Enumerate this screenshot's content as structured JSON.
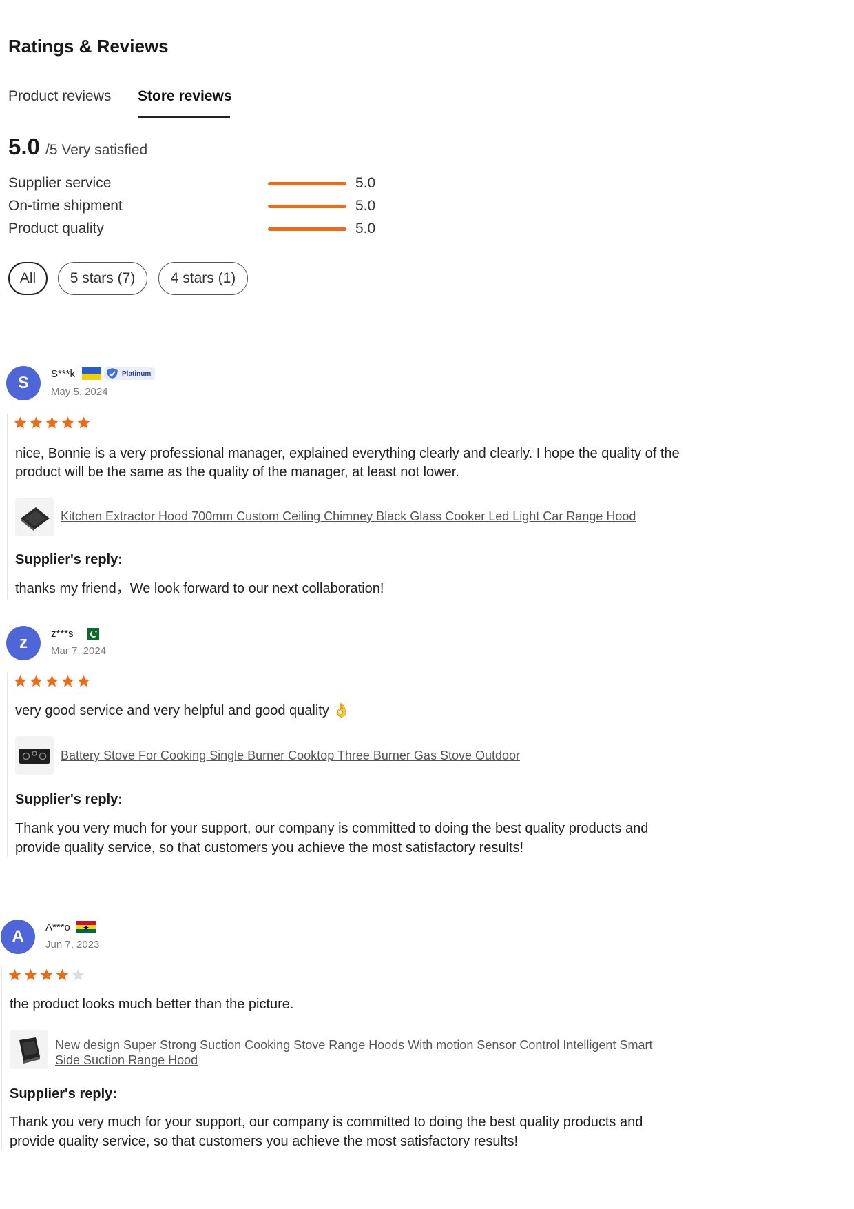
{
  "header": {
    "title": "Ratings & Reviews"
  },
  "tabs": [
    {
      "label": "Product reviews",
      "active": false
    },
    {
      "label": "Store reviews",
      "active": true
    }
  ],
  "summary": {
    "score": "5.0",
    "suffix": "/5 Very satisfied",
    "metrics": [
      {
        "label": "Supplier service",
        "value": "5.0",
        "fraction": 1.0
      },
      {
        "label": "On-time shipment",
        "value": "5.0",
        "fraction": 1.0
      },
      {
        "label": "Product quality",
        "value": "5.0",
        "fraction": 1.0
      }
    ]
  },
  "filters": [
    {
      "label": "All",
      "active": true
    },
    {
      "label": "5 stars (7)",
      "active": false
    },
    {
      "label": "4 stars (1)",
      "active": false
    }
  ],
  "reviews": [
    {
      "initial": "S",
      "user": "S***k",
      "country_flag": "ukraine-flag-icon",
      "badge": "Platinum",
      "date": "May 5, 2024",
      "rating": 5,
      "text": "nice, Bonnie is a very professional manager, explained everything clearly and clearly. I hope the quality of the product will be the same as the quality of the manager, at least not lower.",
      "product": "Kitchen Extractor Hood 700mm Custom Ceiling Chimney Black Glass Cooker Led Light Car Range Hood",
      "reply_label": "Supplier's reply:",
      "reply": "thanks my friend，We look forward to our next collaboration!"
    },
    {
      "initial": "z",
      "user": "z***s",
      "country_flag": "pakistan-flag-icon",
      "date": "Mar 7, 2024",
      "rating": 5,
      "text": "very good service and very helpful and good quality 👌",
      "product": "Battery Stove For Cooking Single Burner Cooktop Three Burner Gas Stove Outdoor",
      "reply_label": "Supplier's reply:",
      "reply": "Thank you very much for your support, our company is committed to doing the best quality products and provide quality service, so that customers you achieve the most satisfactory results!"
    },
    {
      "initial": "A",
      "user": "A***o",
      "country_flag": "ghana-flag-icon",
      "date": "Jun 7, 2023",
      "rating": 4,
      "text": "the product looks much better than the picture.",
      "product": "New design Super Strong Suction Cooking Stove Range Hoods With motion Sensor Control Intelligent Smart Side Suction Range Hood",
      "reply_label": "Supplier's reply:",
      "reply": "Thank you very much for your support, our company is committed to doing the best quality products and provide quality service, so that customers you achieve the most satisfactory results!"
    }
  ],
  "colors": {
    "accent": "#ee6a16",
    "avatar": "#4f66d8",
    "star_empty": "#dddddd"
  }
}
